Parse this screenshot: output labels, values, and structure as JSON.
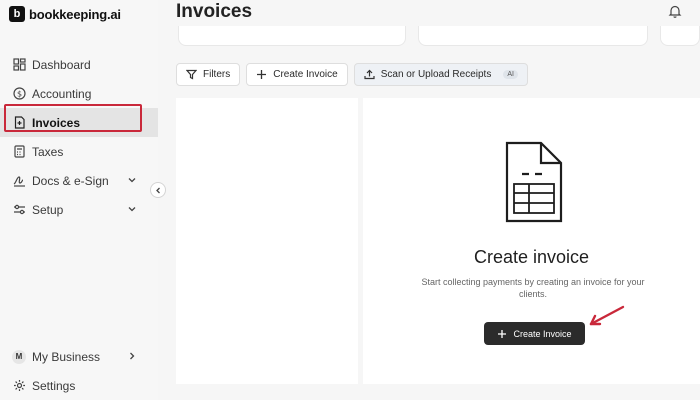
{
  "brand": {
    "name": "bookkeeping.ai",
    "mark": "b"
  },
  "sidebar": {
    "items": [
      {
        "label": "Dashboard"
      },
      {
        "label": "Accounting"
      },
      {
        "label": "Invoices"
      },
      {
        "label": "Taxes"
      },
      {
        "label": "Docs & e-Sign"
      },
      {
        "label": "Setup"
      }
    ],
    "bottom": [
      {
        "label": "My Business",
        "avatar": "M"
      },
      {
        "label": "Settings"
      }
    ]
  },
  "header": {
    "title": "Invoices"
  },
  "toolbar": {
    "filters_label": "Filters",
    "create_label": "Create Invoice",
    "scan_label": "Scan or Upload Receipts",
    "ai_badge": "AI"
  },
  "empty_state": {
    "title": "Create invoice",
    "description": "Start collecting payments by creating an invoice for your clients.",
    "cta_label": "Create Invoice"
  },
  "colors": {
    "highlight": "#c9283a",
    "cta_bg": "#2b2b2b"
  }
}
